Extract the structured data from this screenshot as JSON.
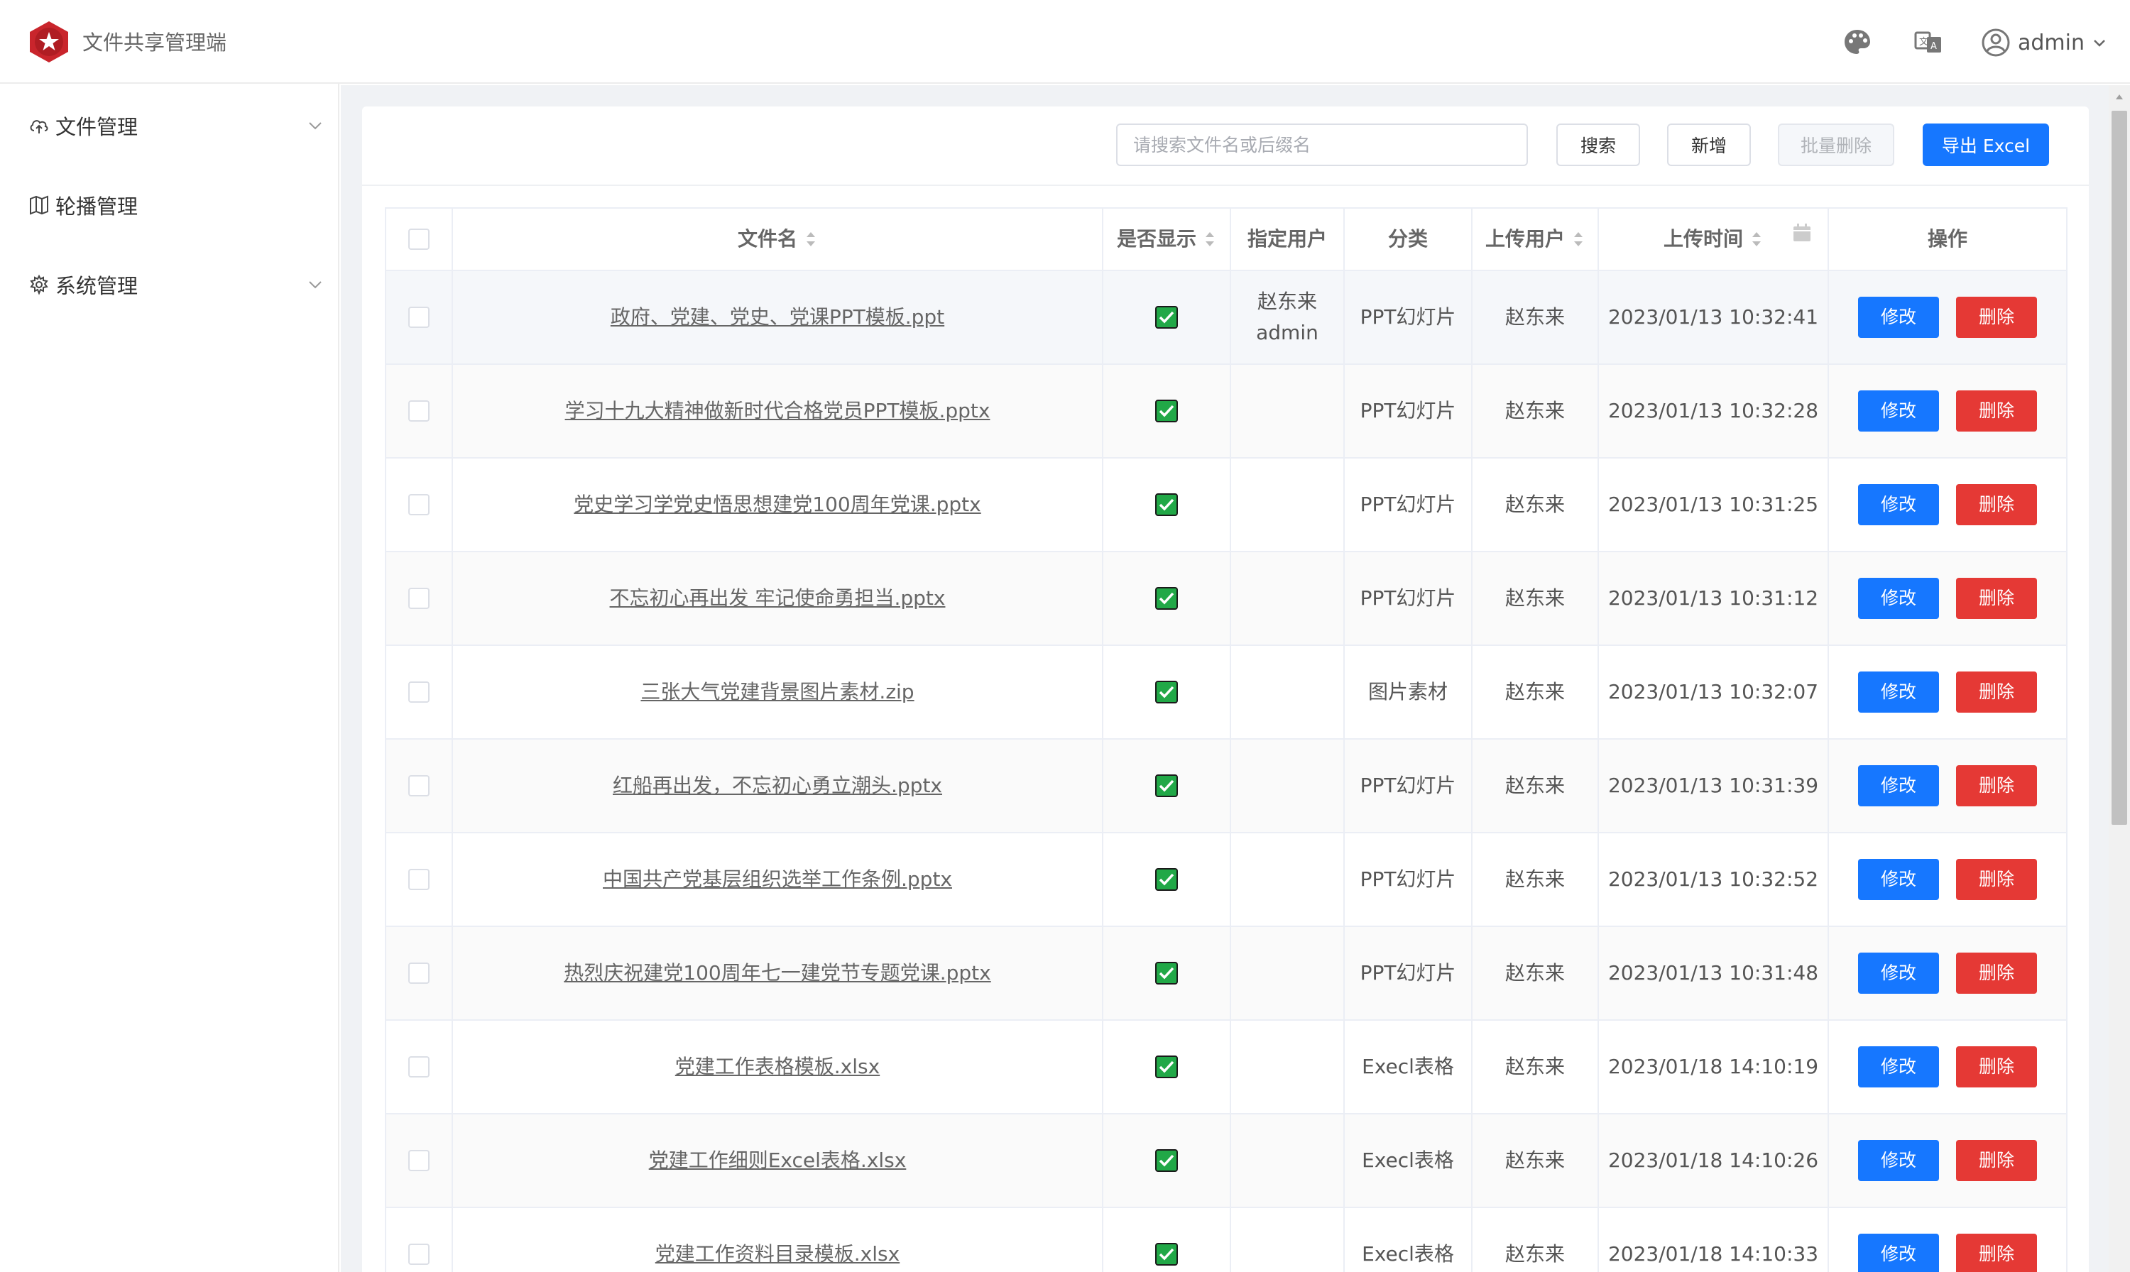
{
  "header": {
    "app_title": "文件共享管理端",
    "user_name": "admin",
    "icons": [
      "palette-icon",
      "translate-icon",
      "user-avatar-icon",
      "chevron-down-icon"
    ]
  },
  "sidebar": {
    "items": [
      {
        "label": "文件管理",
        "icon": "cloud-upload-icon",
        "has_arrow": true
      },
      {
        "label": "轮播管理",
        "icon": "map-icon",
        "has_arrow": false
      },
      {
        "label": "系统管理",
        "icon": "gear-icon",
        "has_arrow": true
      }
    ]
  },
  "toolbar": {
    "search_placeholder": "请搜索文件名或后缀名",
    "search_label": "搜索",
    "add_label": "新增",
    "batch_delete_label": "批量删除",
    "export_label": "导出 Excel"
  },
  "table": {
    "headers": {
      "file_name": "文件名",
      "show": "是否显示",
      "assigned_user": "指定用户",
      "category": "分类",
      "uploader": "上传用户",
      "upload_time": "上传时间",
      "operations": "操作"
    },
    "edit_label": "修改",
    "delete_label": "删除",
    "rows": [
      {
        "file_name": "政府、党建、党史、党课PPT模板.ppt",
        "show": true,
        "assigned_user": "赵东来\nadmin",
        "category": "PPT幻灯片",
        "uploader": "赵东来",
        "upload_time": "2023/01/13 10:32:41"
      },
      {
        "file_name": "学习十九大精神做新时代合格党员PPT模板.pptx",
        "show": true,
        "assigned_user": "",
        "category": "PPT幻灯片",
        "uploader": "赵东来",
        "upload_time": "2023/01/13 10:32:28"
      },
      {
        "file_name": "党史学习学党史悟思想建党100周年党课.pptx",
        "show": true,
        "assigned_user": "",
        "category": "PPT幻灯片",
        "uploader": "赵东来",
        "upload_time": "2023/01/13 10:31:25"
      },
      {
        "file_name": "不忘初心再出发 牢记使命勇担当.pptx",
        "show": true,
        "assigned_user": "",
        "category": "PPT幻灯片",
        "uploader": "赵东来",
        "upload_time": "2023/01/13 10:31:12"
      },
      {
        "file_name": "三张大气党建背景图片素材.zip",
        "show": true,
        "assigned_user": "",
        "category": "图片素材",
        "uploader": "赵东来",
        "upload_time": "2023/01/13 10:32:07"
      },
      {
        "file_name": "红船再出发，不忘初心勇立潮头.pptx",
        "show": true,
        "assigned_user": "",
        "category": "PPT幻灯片",
        "uploader": "赵东来",
        "upload_time": "2023/01/13 10:31:39"
      },
      {
        "file_name": "中国共产党基层组织选举工作条例.pptx",
        "show": true,
        "assigned_user": "",
        "category": "PPT幻灯片",
        "uploader": "赵东来",
        "upload_time": "2023/01/13 10:32:52"
      },
      {
        "file_name": "热烈庆祝建党100周年七一建党节专题党课.pptx",
        "show": true,
        "assigned_user": "",
        "category": "PPT幻灯片",
        "uploader": "赵东来",
        "upload_time": "2023/01/13 10:31:48"
      },
      {
        "file_name": "党建工作表格模板.xlsx",
        "show": true,
        "assigned_user": "",
        "category": "Execl表格",
        "uploader": "赵东来",
        "upload_time": "2023/01/18 14:10:19"
      },
      {
        "file_name": "党建工作细则Excel表格.xlsx",
        "show": true,
        "assigned_user": "",
        "category": "Execl表格",
        "uploader": "赵东来",
        "upload_time": "2023/01/18 14:10:26"
      },
      {
        "file_name": "党建工作资料目录模板.xlsx",
        "show": true,
        "assigned_user": "",
        "category": "Execl表格",
        "uploader": "赵东来",
        "upload_time": "2023/01/18 14:10:33"
      }
    ]
  },
  "colors": {
    "primary": "#1677ff",
    "danger": "#e53935",
    "check_green": "#21a847",
    "logo_red": "#c9252c"
  }
}
